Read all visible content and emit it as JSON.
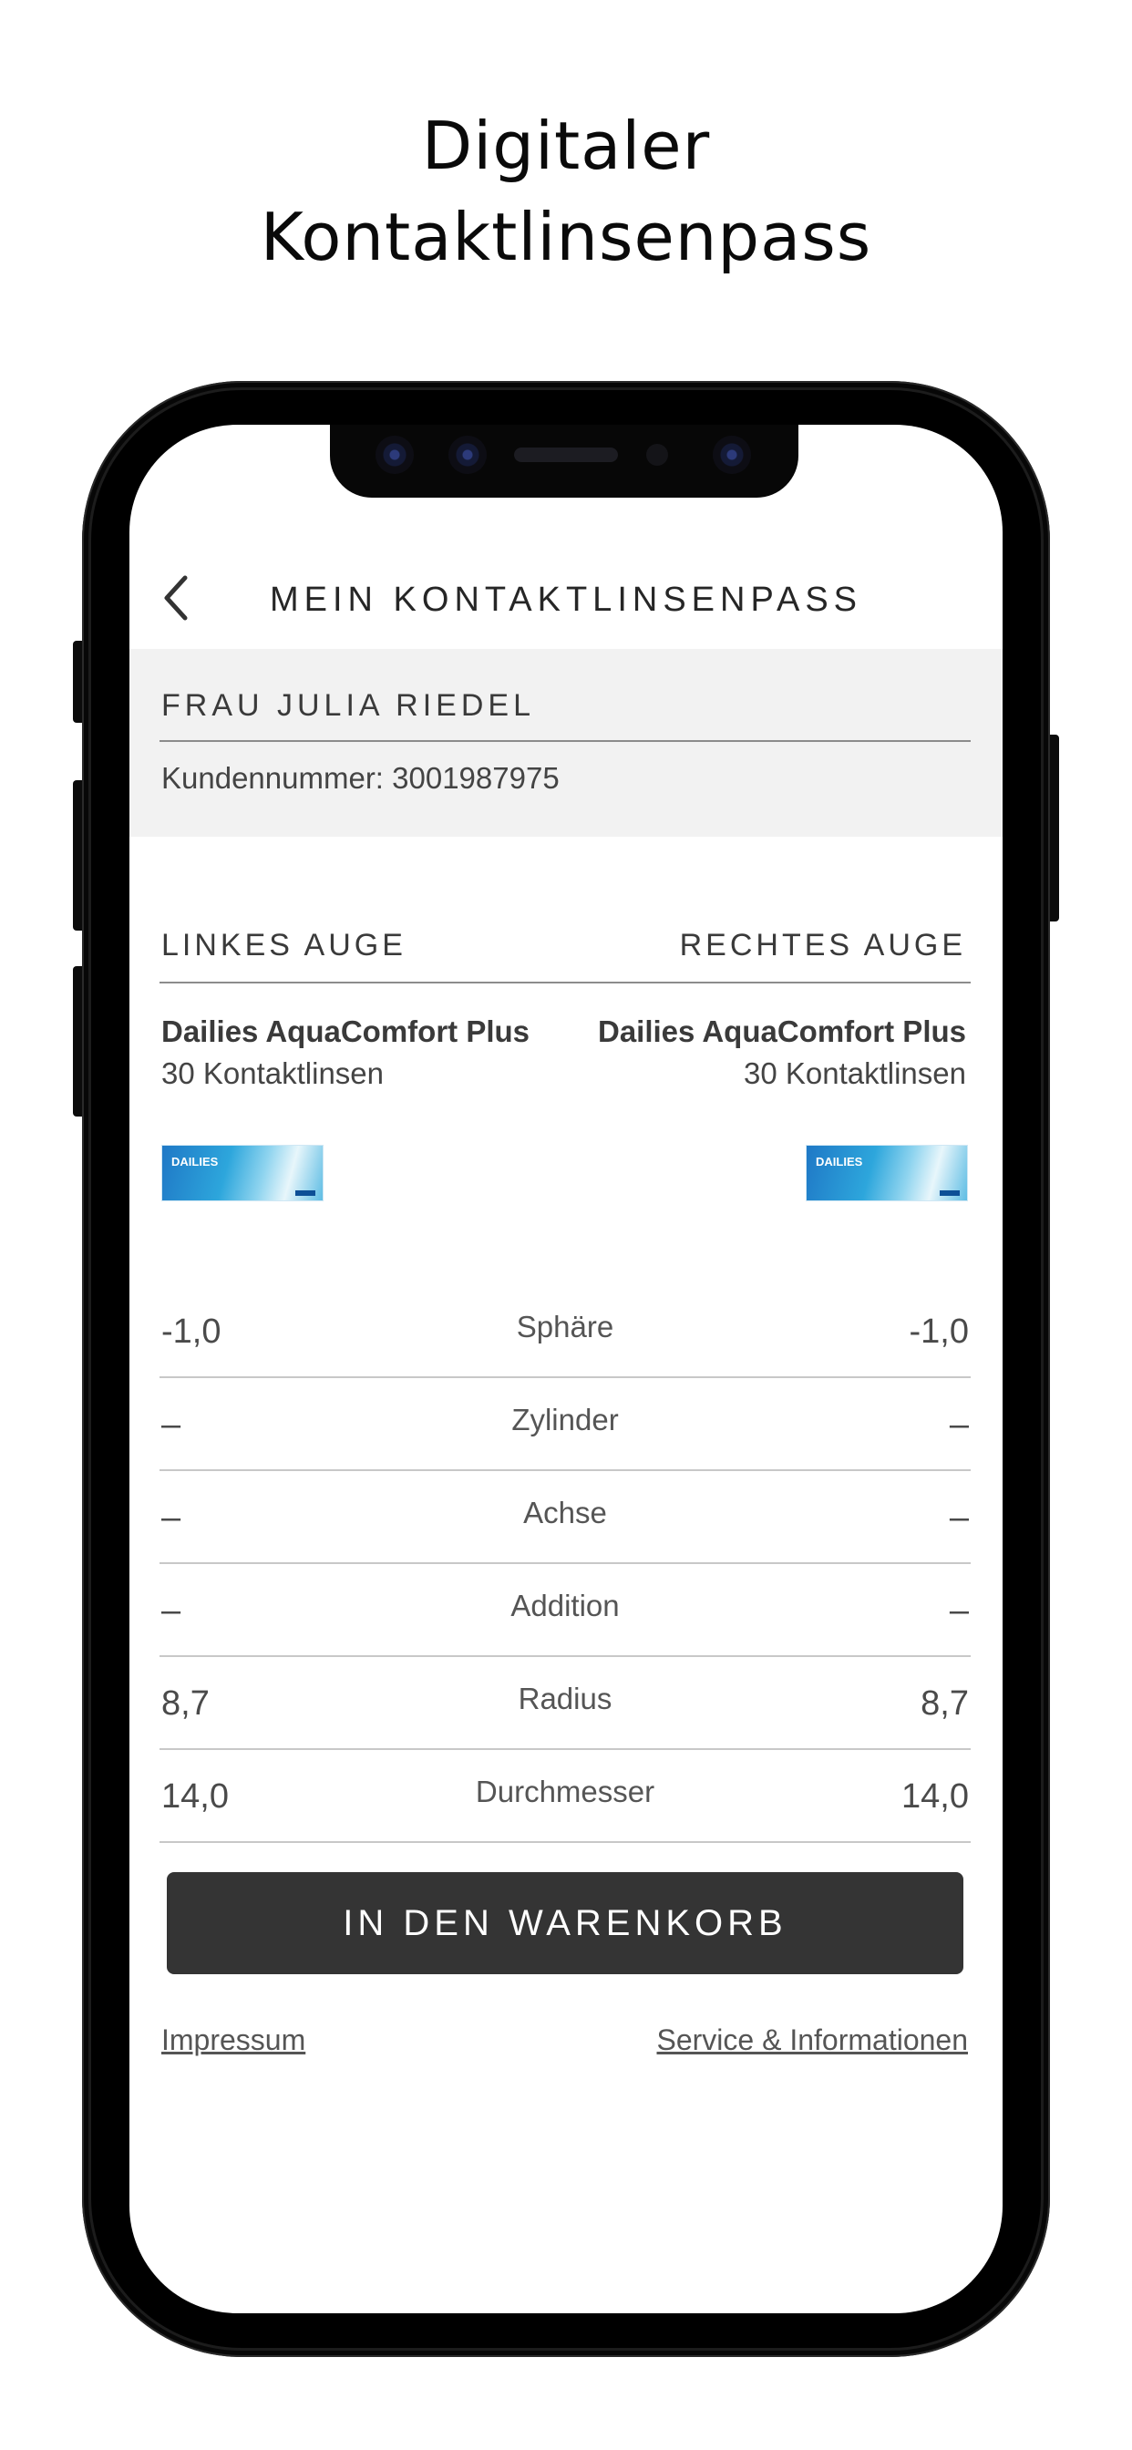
{
  "promo": {
    "title_line1": "Digitaler",
    "title_line2": "Kontaktlinsenpass"
  },
  "header": {
    "title": "MEIN KONTAKTLINSENPASS",
    "back_icon": "chevron-left-icon"
  },
  "customer": {
    "name": "FRAU JULIA RIEDEL",
    "number": "Kundennummer: 3001987975"
  },
  "eyes": {
    "left": {
      "heading": "LINKES AUGE",
      "product": "Dailies AquaComfort Plus",
      "quantity": "30 Kontaktlinsen"
    },
    "right": {
      "heading": "RECHTES AUGE",
      "product": "Dailies AquaComfort Plus",
      "quantity": "30 Kontaktlinsen"
    }
  },
  "package_label": "DAILIES",
  "parameters": [
    {
      "label": "Sphäre",
      "left": "-1,0",
      "right": "-1,0"
    },
    {
      "label": "Zylinder",
      "left": "–",
      "right": "–"
    },
    {
      "label": "Achse",
      "left": "–",
      "right": "–"
    },
    {
      "label": "Addition",
      "left": "–",
      "right": "–"
    },
    {
      "label": "Radius",
      "left": "8,7",
      "right": "8,7"
    },
    {
      "label": "Durchmesser",
      "left": "14,0",
      "right": "14,0"
    }
  ],
  "actions": {
    "add_to_cart": "IN DEN WARENKORB"
  },
  "footer": {
    "imprint": "Impressum",
    "service": "Service & Informationen"
  }
}
